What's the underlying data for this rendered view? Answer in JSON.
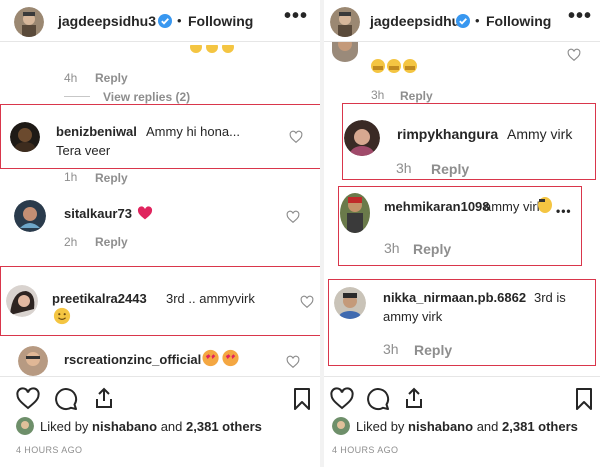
{
  "left": {
    "header": {
      "username": "jagdeepsidhu3",
      "dot": "•",
      "follow": "Following",
      "more": "•••"
    },
    "top_meta": {
      "time": "4h",
      "reply": "Reply",
      "view_replies": "View replies (2)"
    },
    "comments": [
      {
        "username": "benizbeniwal",
        "text1": "Ammy hi hona...",
        "text2": "Tera veer",
        "time": "1h",
        "reply": "Reply"
      },
      {
        "username": "sitalkaur73",
        "time": "2h",
        "reply": "Reply"
      },
      {
        "username": "preetikalra2443",
        "text1": "3rd .. ammyvirk"
      },
      {
        "username": "rscreationzinc_official"
      }
    ],
    "likes": {
      "prefix": "Liked by",
      "user": "nishabano",
      "mid": "and",
      "count": "2,381 others"
    },
    "timestamp": "4 HOURS AGO"
  },
  "right": {
    "header": {
      "username": "jagdeepsidhu3",
      "dot": "•",
      "follow": "Following",
      "more": "•••"
    },
    "top_meta": {
      "time": "3h",
      "reply": "Reply"
    },
    "comments": [
      {
        "username": "rimpykhangura",
        "text1": "Ammy virk",
        "time": "3h",
        "reply": "Reply"
      },
      {
        "username": "mehmikaran1098",
        "text1": "ammy virk",
        "time": "3h",
        "reply": "Reply",
        "more": "•••"
      },
      {
        "username": "nikka_nirmaan.pb.6862",
        "text1": "3rd is",
        "text2": "ammy virk",
        "time": "3h",
        "reply": "Reply"
      }
    ],
    "likes": {
      "prefix": "Liked by",
      "user": "nishabano",
      "mid": "and",
      "count": "2,381 others"
    },
    "timestamp": "4 HOURS AGO"
  },
  "colors": {
    "highlight": "#d9364b",
    "verified": "#3897f0",
    "meta": "#8e8e8e"
  }
}
